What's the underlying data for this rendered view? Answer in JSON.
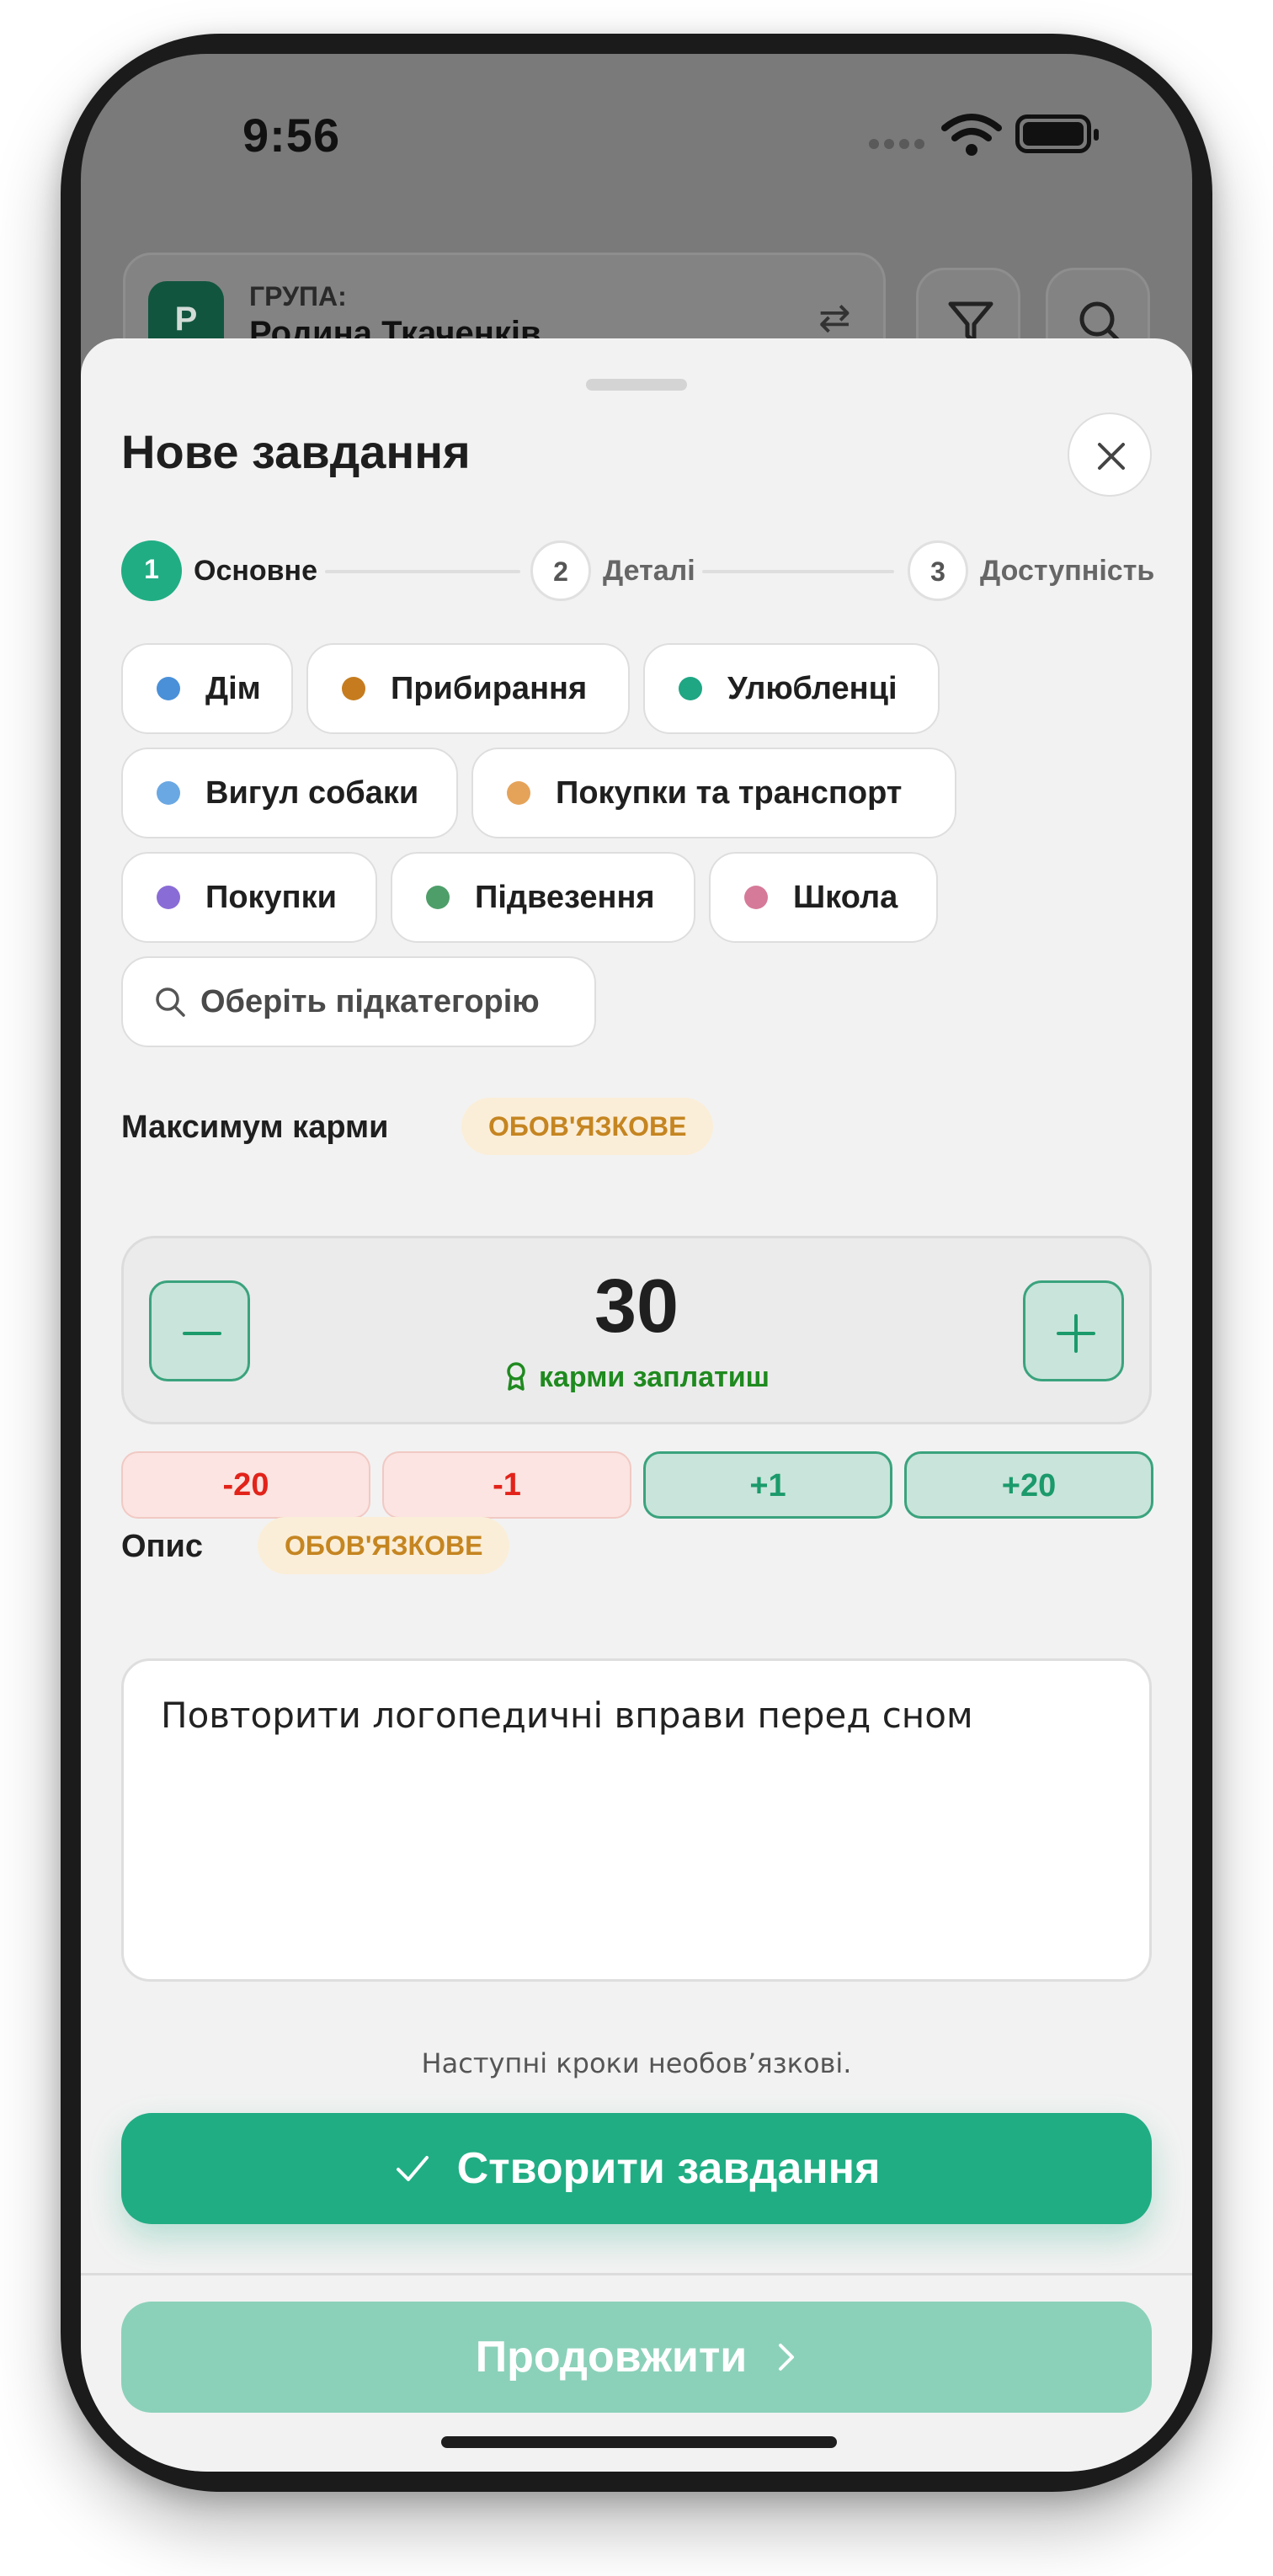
{
  "status_bar": {
    "time": "9:56"
  },
  "background": {
    "group_avatar_letter": "P",
    "group_label": "ГРУПА:",
    "group_name": "Родина Ткаченків"
  },
  "sheet": {
    "title": "Нове завдання",
    "steps": [
      {
        "number": "1",
        "label": "Основне",
        "active": true
      },
      {
        "number": "2",
        "label": "Деталі",
        "active": false
      },
      {
        "number": "3",
        "label": "Доступність",
        "active": false
      }
    ],
    "categories": [
      {
        "label": "Дім",
        "color": "#4a90d9"
      },
      {
        "label": "Прибирання",
        "color": "#c67c1e"
      },
      {
        "label": "Улюбленці",
        "color": "#1fa683"
      },
      {
        "label": "Вигул собаки",
        "color": "#6aa8e3"
      },
      {
        "label": "Покупки та транспорт",
        "color": "#e5a35a"
      },
      {
        "label": "Покупки",
        "color": "#8a6cd6"
      },
      {
        "label": "Підвезення",
        "color": "#4e9e69"
      },
      {
        "label": "Школа",
        "color": "#d67a9a"
      }
    ],
    "subcategory_placeholder": "Оберіть підкатегорію",
    "karma": {
      "label": "Максимум карми",
      "required_badge": "ОБОВ'ЯЗКОВЕ",
      "value": "30",
      "caption": "карми заплатиш",
      "quick_adjust": [
        "-20",
        "-1",
        "+1",
        "+20"
      ]
    },
    "description": {
      "label": "Опис",
      "required_badge": "ОБОВ'ЯЗКОВЕ",
      "value": "Повторити логопедичні вправи перед сном"
    },
    "hint": "Наступні кроки необов’язкові.",
    "create_button": "Створити завдання",
    "continue_button": "Продовжити"
  },
  "colors": {
    "accent": "#20ad84",
    "accent_light": "#8bd1b9",
    "required": "#c58521",
    "negative": "#e2231a",
    "positive_caption": "#1f8a1f"
  }
}
